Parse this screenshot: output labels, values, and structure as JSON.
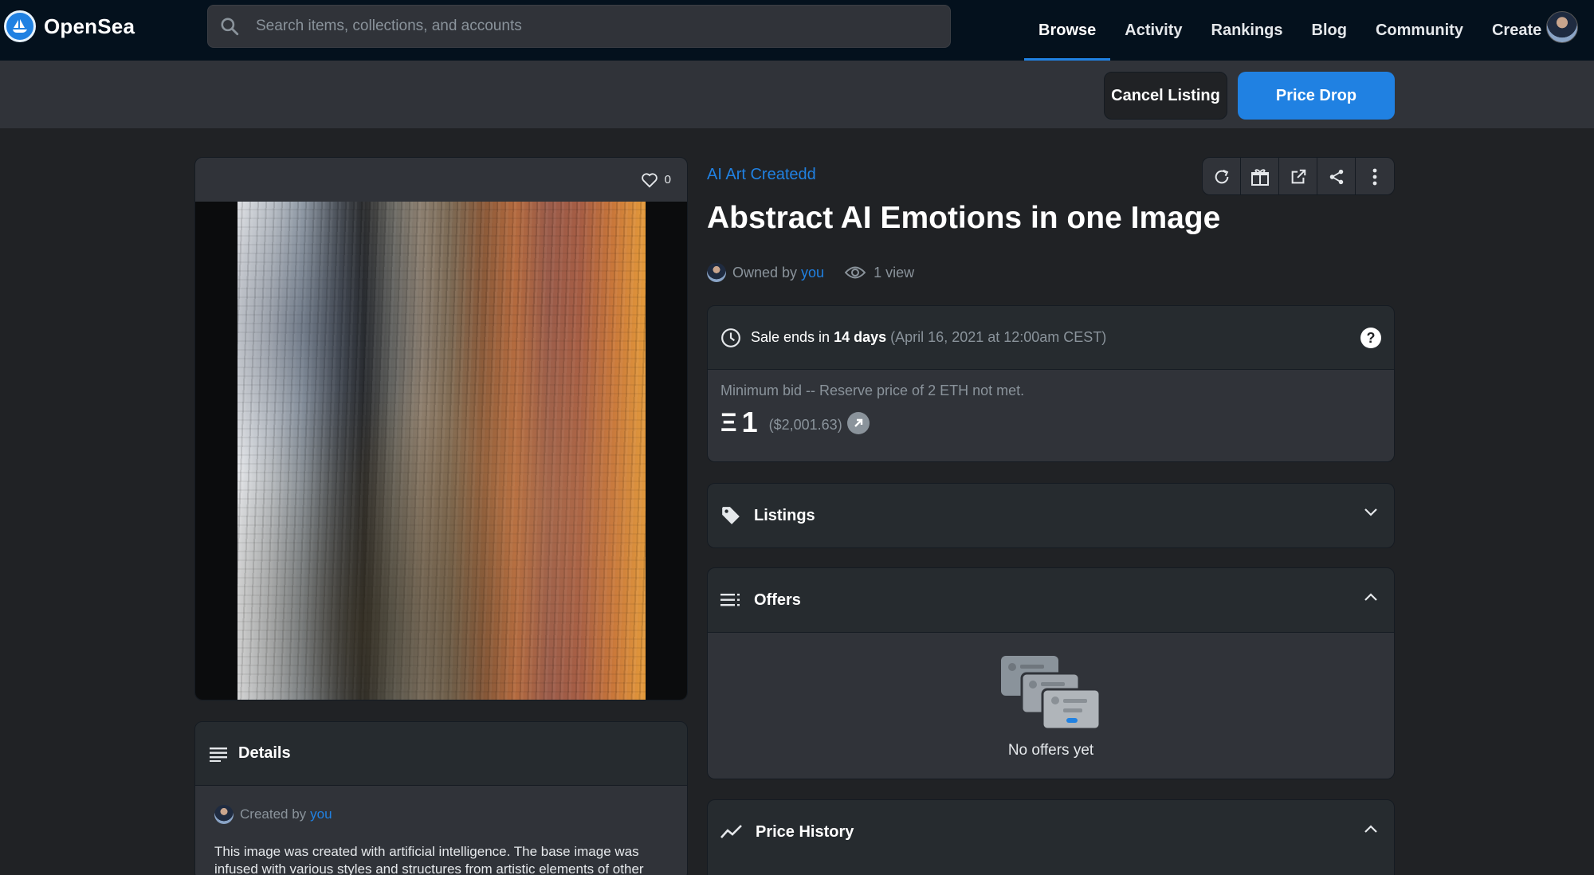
{
  "brand": {
    "name": "OpenSea"
  },
  "search": {
    "placeholder": "Search items, collections, and accounts"
  },
  "nav": {
    "links": [
      "Browse",
      "Activity",
      "Rankings",
      "Blog",
      "Community",
      "Create"
    ],
    "active": "Browse"
  },
  "actions": {
    "cancel_label": "Cancel Listing",
    "drop_label": "Price Drop"
  },
  "media": {
    "likes": "0"
  },
  "details": {
    "title": "Details",
    "created_prefix": "Created by",
    "created_by": "you",
    "description": "This image was created with artificial intelligence. The base image was infused with various styles and structures from artistic elements of other"
  },
  "item": {
    "collection": "AI Art Createdd",
    "title": "Abstract AI Emotions in one Image",
    "owned_prefix": "Owned by",
    "owner": "you",
    "views": "1 view"
  },
  "sale": {
    "prefix": "Sale ends in",
    "duration": "14 days",
    "date": "(April 16, 2021 at 12:00am CEST)",
    "min_bid_text": "Minimum bid -- Reserve price of 2 ETH not met.",
    "eth_symbol": "Ξ",
    "price": "1",
    "usd": "($2,001.63)"
  },
  "panels": {
    "listings": "Listings",
    "offers": "Offers",
    "no_offers": "No offers yet",
    "price_history": "Price History"
  },
  "colors": {
    "accent": "#2081e2",
    "bg": "#202225",
    "panel": "#303339",
    "nav": "#04111d"
  }
}
